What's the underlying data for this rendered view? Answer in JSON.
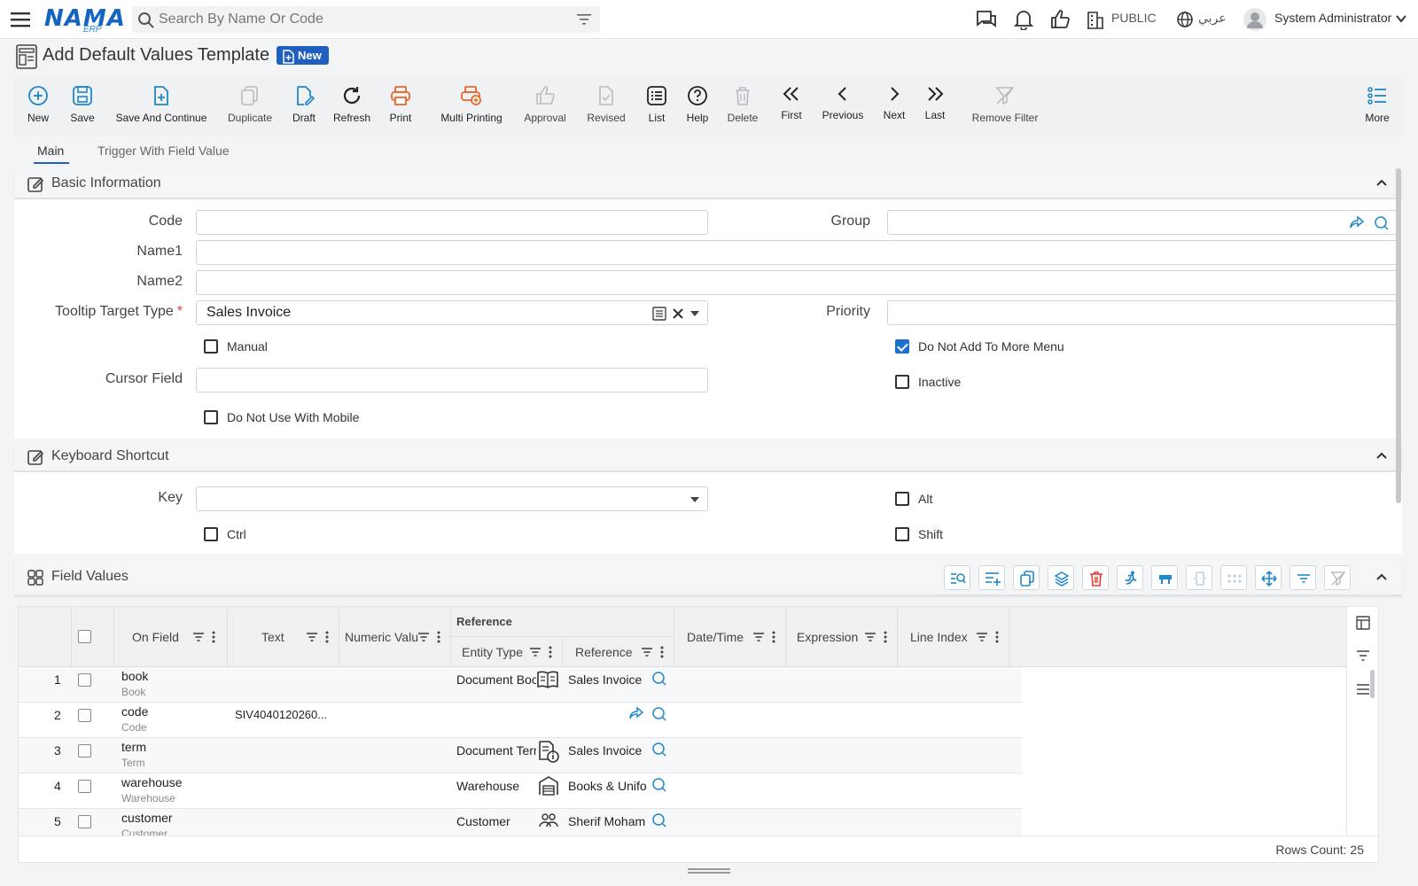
{
  "header": {
    "logo_text": "NAMA",
    "logo_sub": "ERP",
    "search_placeholder": "Search By Name Or Code",
    "public_label": "PUBLIC",
    "lang_label": "عربي",
    "user_name": "System Administrator"
  },
  "page": {
    "title": "Add Default Values Template",
    "status_badge": "New"
  },
  "toolbar": [
    {
      "label": "New",
      "icon": "plus-circle-icon"
    },
    {
      "label": "Save",
      "icon": "save-icon"
    },
    {
      "label": "Save And Continue",
      "icon": "file-plus-icon"
    },
    {
      "label": "Duplicate",
      "icon": "duplicate-icon"
    },
    {
      "label": "Draft",
      "icon": "draft-icon"
    },
    {
      "label": "Refresh",
      "icon": "refresh-icon"
    },
    {
      "label": "Print",
      "icon": "print-icon"
    },
    {
      "label": "Multi Printing",
      "icon": "multi-print-icon"
    },
    {
      "label": "Approval",
      "icon": "thumbs-up-icon"
    },
    {
      "label": "Revised",
      "icon": "revised-icon"
    },
    {
      "label": "List",
      "icon": "list-icon"
    },
    {
      "label": "Help",
      "icon": "help-icon"
    },
    {
      "label": "Delete",
      "icon": "trash-icon"
    },
    {
      "label": "First",
      "icon": "first-icon"
    },
    {
      "label": "Previous",
      "icon": "previous-icon"
    },
    {
      "label": "Next",
      "icon": "next-icon"
    },
    {
      "label": "Last",
      "icon": "last-icon"
    },
    {
      "label": "Remove Filter",
      "icon": "remove-filter-icon"
    },
    {
      "label": "More",
      "icon": "more-icon"
    }
  ],
  "tabs": [
    "Main",
    "Trigger With Field Value"
  ],
  "basic": {
    "title": "Basic Information",
    "code_label": "Code",
    "code_value": "",
    "group_label": "Group",
    "group_value": "",
    "name1_label": "Name1",
    "name1_value": "",
    "name2_label": "Name2",
    "name2_value": "",
    "target_label": "Tooltip Target Type",
    "target_value": "Sales Invoice",
    "priority_label": "Priority",
    "priority_value": "",
    "manual_label": "Manual",
    "manual_checked": false,
    "no_more_menu_label": "Do Not Add To More Menu",
    "no_more_menu_checked": true,
    "cursor_label": "Cursor Field",
    "cursor_value": "",
    "inactive_label": "Inactive",
    "inactive_checked": false,
    "no_mobile_label": "Do Not Use With Mobile",
    "no_mobile_checked": false
  },
  "shortcut": {
    "title": "Keyboard Shortcut",
    "key_label": "Key",
    "key_value": "",
    "alt_label": "Alt",
    "ctrl_label": "Ctrl",
    "shift_label": "Shift"
  },
  "field_values": {
    "title": "Field Values",
    "columns": {
      "on_field": "On Field",
      "text": "Text",
      "numeric": "Numeric Valu",
      "reference_group": "Reference",
      "entity_type": "Entity Type",
      "reference": "Reference",
      "datetime": "Date/Time",
      "expression": "Expression",
      "line_index": "Line Index"
    },
    "rows": [
      {
        "n": "1",
        "field": "book",
        "field_sub": "Book",
        "text": "",
        "numeric": "",
        "entity": "Document Boo",
        "ref": "Sales Invoice"
      },
      {
        "n": "2",
        "field": "code",
        "field_sub": "Code",
        "text": "SIV4040120260...",
        "numeric": "",
        "entity": "",
        "ref": ""
      },
      {
        "n": "3",
        "field": "term",
        "field_sub": "Term",
        "text": "",
        "numeric": "",
        "entity": "Document Terr",
        "ref": "Sales Invoice"
      },
      {
        "n": "4",
        "field": "warehouse",
        "field_sub": "Warehouse",
        "text": "",
        "numeric": "",
        "entity": "Warehouse",
        "ref": "Books & Unifo"
      },
      {
        "n": "5",
        "field": "customer",
        "field_sub": "Customer",
        "text": "",
        "numeric": "",
        "entity": "Customer",
        "ref": "Sherif Moham"
      }
    ],
    "rows_count": "Rows Count: 25"
  },
  "colors": {
    "accent": "#1f5fbf",
    "print_orange": "#e8672a",
    "danger": "#e53935",
    "teal": "#1e88c8"
  }
}
